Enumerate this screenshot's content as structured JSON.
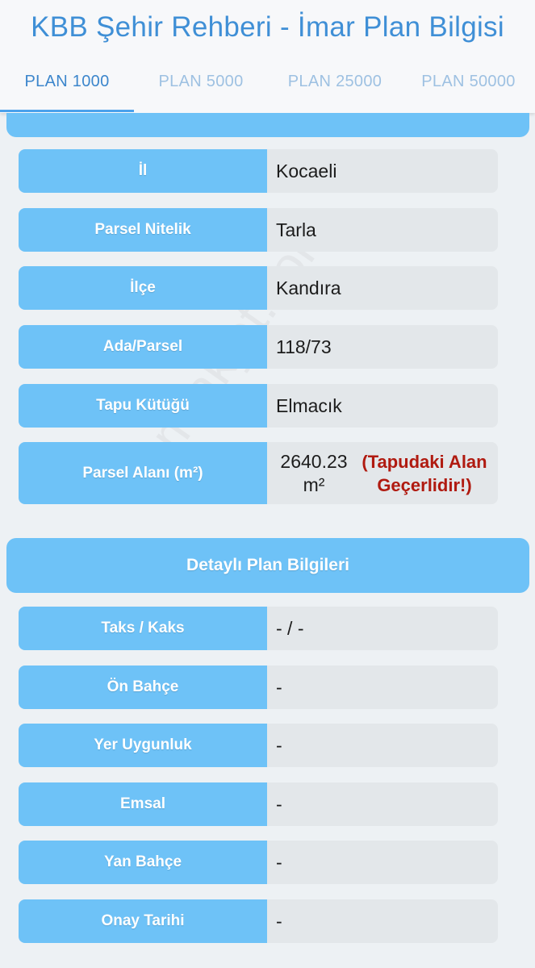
{
  "header": {
    "title": "KBB Şehir Rehberi - İmar Plan Bilgisi",
    "tabs": [
      {
        "label": "PLAN 1000",
        "active": true
      },
      {
        "label": "PLAN 5000",
        "active": false
      },
      {
        "label": "PLAN 25000",
        "active": false
      },
      {
        "label": "PLAN 50000",
        "active": false
      }
    ]
  },
  "parcel_info": [
    {
      "label": "İl",
      "value": "Kocaeli"
    },
    {
      "label": "Parsel Nitelik",
      "value": "Tarla"
    },
    {
      "label": "İlçe",
      "value": "Kandıra"
    },
    {
      "label": "Ada/Parsel",
      "value": "118/73"
    },
    {
      "label": "Tapu Kütüğü",
      "value": "Elmacık"
    },
    {
      "label": "Parsel Alanı (m²)",
      "value": "2640.23 m²",
      "note": "(Tapudaki Alan Geçerlidir!)"
    }
  ],
  "detail_section": {
    "title": "Detaylı Plan Bilgileri",
    "rows": [
      {
        "label": "Taks / Kaks",
        "value": "- / -"
      },
      {
        "label": "Ön Bahçe",
        "value": "-"
      },
      {
        "label": "Yer Uygunluk",
        "value": "-"
      },
      {
        "label": "Emsal",
        "value": "-"
      },
      {
        "label": "Yan Bahçe",
        "value": "-"
      },
      {
        "label": "Onay Tarihi",
        "value": "-"
      }
    ]
  },
  "watermark": "emlakjet.com",
  "colors": {
    "title": "#3f8fd6",
    "accent_blue": "#6ec2f7",
    "value_bg": "#e3e7ea",
    "warning_red": "#b01a10"
  }
}
